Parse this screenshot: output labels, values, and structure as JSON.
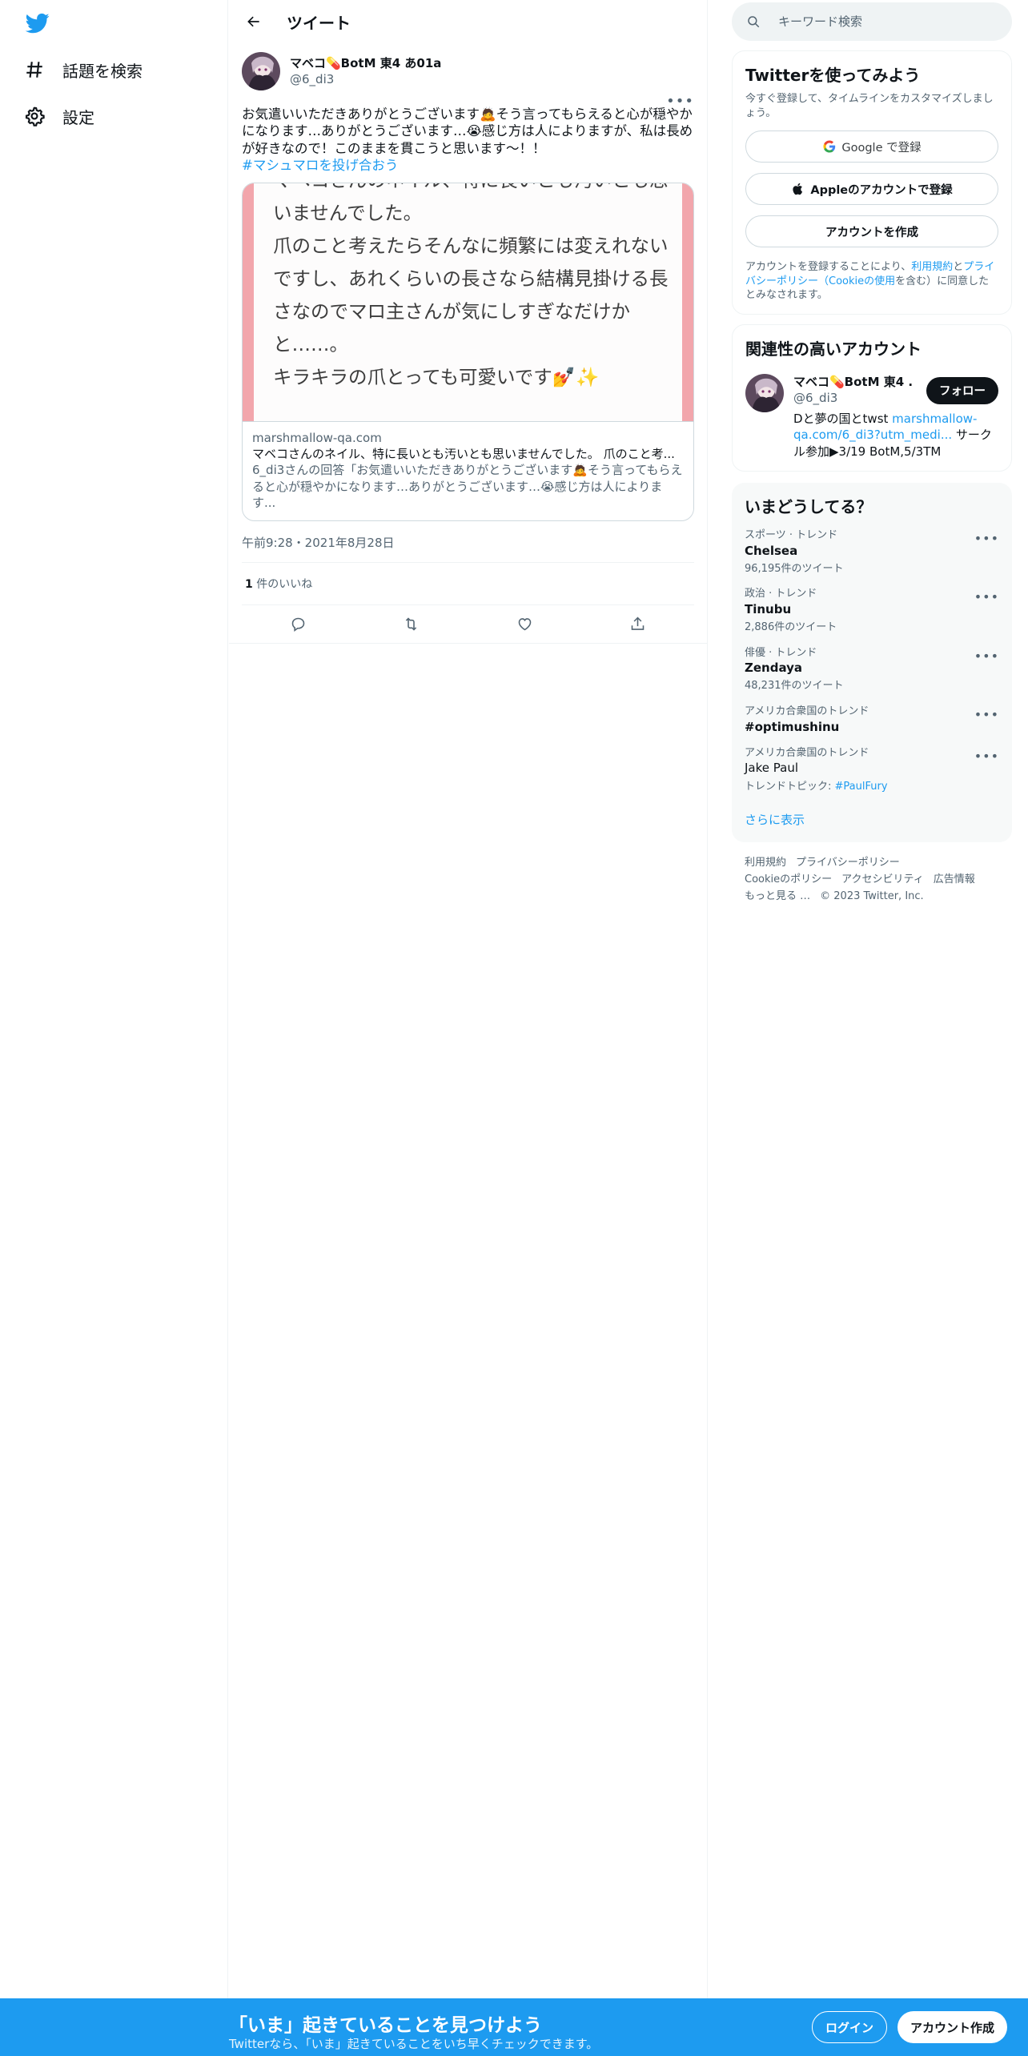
{
  "nav": {
    "explore_label": "話題を検索",
    "settings_label": "設定"
  },
  "header": {
    "title": "ツイート"
  },
  "tweet": {
    "author_name": "マベコ💊BotM 東4 あ01a",
    "author_handle": "@6_di3",
    "text": "お気遣いいただきありがとうございます🙇そう言ってもらえると心が穏やかになります…ありがとうございます…😭感じ方は人によりますが、私は長めが好きなので！このままを貫こうと思います〜！！",
    "hashtag": "#マシュマロを投げ合おう",
    "card": {
      "image_lines": [
        "マベコさんのネイル、特に長いとも汚いとも思",
        "いませんでした。",
        "爪のこと考えたらそんなに頻繁には変えれない",
        "ですし、あれくらいの長さなら結構見掛ける長",
        "さなのでマロ主さんが気にしすぎなだけか",
        "と……。",
        "キラキラの爪とっても可愛いです💅✨"
      ],
      "domain": "marshmallow-qa.com",
      "title": "マベコさんのネイル、特に長いとも汚いとも思いませんでした。 爪のこと考...",
      "description": "6_di3さんの回答「お気遣いいただきありがとうございます🙇そう言ってもらえると心が穏やかになります…ありがとうございます…😭感じ方は人によります..."
    },
    "timestamp": "午前9:28・2021年8月28日",
    "likes_count": "1",
    "likes_label": "件のいいね"
  },
  "search": {
    "placeholder": "キーワード検索"
  },
  "signup_panel": {
    "title": "Twitterを使ってみよう",
    "subtitle": "今すぐ登録して、タイムラインをカスタマイズしましょう。",
    "google_label": "Google で登録",
    "apple_label": "Appleのアカウントで登録",
    "create_label": "アカウントを作成",
    "legal_prefix": "アカウントを登録することにより、",
    "legal_terms": "利用規約",
    "legal_and": "と",
    "legal_privacy": "プライバシーポリシー（Cookieの使用",
    "legal_suffix": "を含む）に同意したとみなされます。"
  },
  "related": {
    "title": "関連性の高いアカウント",
    "name": "マベコ💊BotM 東4 ...",
    "handle": "@6_di3",
    "bio_prefix": "Dと夢の国とtwst ",
    "bio_link": "marshmallow-qa.com/6_di3?utm_medi...",
    "bio_suffix": " サークル参加▶3/19 BotM,5/3TM",
    "follow_label": "フォロー"
  },
  "trends": {
    "title": "いまどうしてる？",
    "items": [
      {
        "category": "スポーツ · トレンド",
        "name": "Chelsea",
        "count": "96,195件のツイート"
      },
      {
        "category": "政治 · トレンド",
        "name": "Tinubu",
        "count": "2,886件のツイート"
      },
      {
        "category": "俳優 · トレンド",
        "name": "Zendaya",
        "count": "48,231件のツイート"
      },
      {
        "category": "アメリカ合衆国のトレンド",
        "name": "#optimushinu",
        "count": ""
      },
      {
        "category": "アメリカ合衆国のトレンド",
        "name": "Jake Paul",
        "count_prefix": "トレンドトピック: ",
        "count_link": "#PaulFury"
      }
    ],
    "show_more": "さらに表示"
  },
  "footer": {
    "links": [
      "利用規約",
      "プライバシーポリシー",
      "Cookieのポリシー",
      "アクセシビリティ",
      "広告情報",
      "もっと見る …"
    ],
    "copyright": "© 2023 Twitter, Inc."
  },
  "bottom_bar": {
    "title": "「いま」起きていることを見つけよう",
    "subtitle": "Twitterなら、「いま」起きていることをいち早くチェックできます。",
    "login_label": "ログイン",
    "signup_label": "アカウント作成"
  },
  "colors": {
    "accent": "#1d9bf0",
    "text_primary": "#0f1419",
    "text_secondary": "#536471",
    "card_image_border": "#f2a6ac"
  },
  "icons": [
    "twitter-logo-icon",
    "hashtag-icon",
    "gear-icon",
    "back-arrow-icon",
    "more-icon",
    "search-icon",
    "google-icon",
    "apple-icon",
    "reply-icon",
    "retweet-icon",
    "like-icon",
    "share-icon"
  ]
}
